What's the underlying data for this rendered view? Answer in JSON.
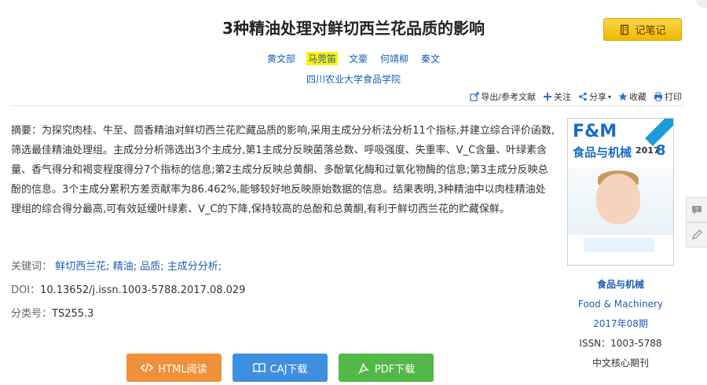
{
  "article": {
    "title": "3种精油处理对鲜切西兰花品质的影响",
    "authors": [
      "黄文部",
      "马莞笛",
      "文豪",
      "何靖柳",
      "秦文"
    ],
    "affiliation": "四川农业大学食品学院",
    "abstract_label": "摘要：",
    "abstract": "为探究肉桂、牛至、茴香精油对鲜切西兰花贮藏品质的影响,采用主成分分析法分析11个指标,并建立综合评价函数,筛选最佳精油处理组。主成分分析筛选出3个主成分,第1主成分反映菌落总数、呼吸强度、失重率、V_C含量、叶绿素含量、香气得分和褐变程度得分7个指标的信息;第2主成分反映总黄酮、多酚氧化酶和过氧化物酶的信息;第3主成分反映总酚的信息。3个主成分累积方差贡献率为86.462%,能够较好地反映原始数据的信息。结果表明,3种精油中以肉桂精油处理组的综合得分最高,可有效延缓叶绿素、V_C的下降,保持较高的总酚和总黄酮,有利于鲜切西兰花的贮藏保鲜。",
    "keywords_label": "关键词：",
    "keywords": [
      "鲜切西兰花;",
      "精油;",
      "品质;",
      "主成分分析;"
    ],
    "doi_label": "DOI：",
    "doi": "10.13652/j.issn.1003-5788.2017.08.029",
    "class_label": "分类号：",
    "class_no": "TS255.3"
  },
  "header": {
    "note_button": "记笔记"
  },
  "toolbar": {
    "export": "导出/参考文献",
    "follow": "关注",
    "share": "分享",
    "favorite": "收藏",
    "print": "打印"
  },
  "downloads": {
    "html": "HTML阅读",
    "caj": "CAJ下载",
    "pdf": "PDF下载"
  },
  "journal": {
    "cover_logo": "F&M",
    "cover_cn": "食品与机械",
    "cover_year": "2017",
    "cover_no": "8",
    "name_cn": "食品与机械",
    "name_en": "Food & Machinery",
    "issue": "2017年08期",
    "issn": "ISSN：1003-5788",
    "core": "中文核心期刊"
  },
  "colors": {
    "link": "#1a5fb4",
    "highlight": "#fff200",
    "html_btn": "#f0913a",
    "caj_btn": "#3d8fe0",
    "pdf_btn": "#52b847",
    "note_btn": "#f0b800"
  }
}
